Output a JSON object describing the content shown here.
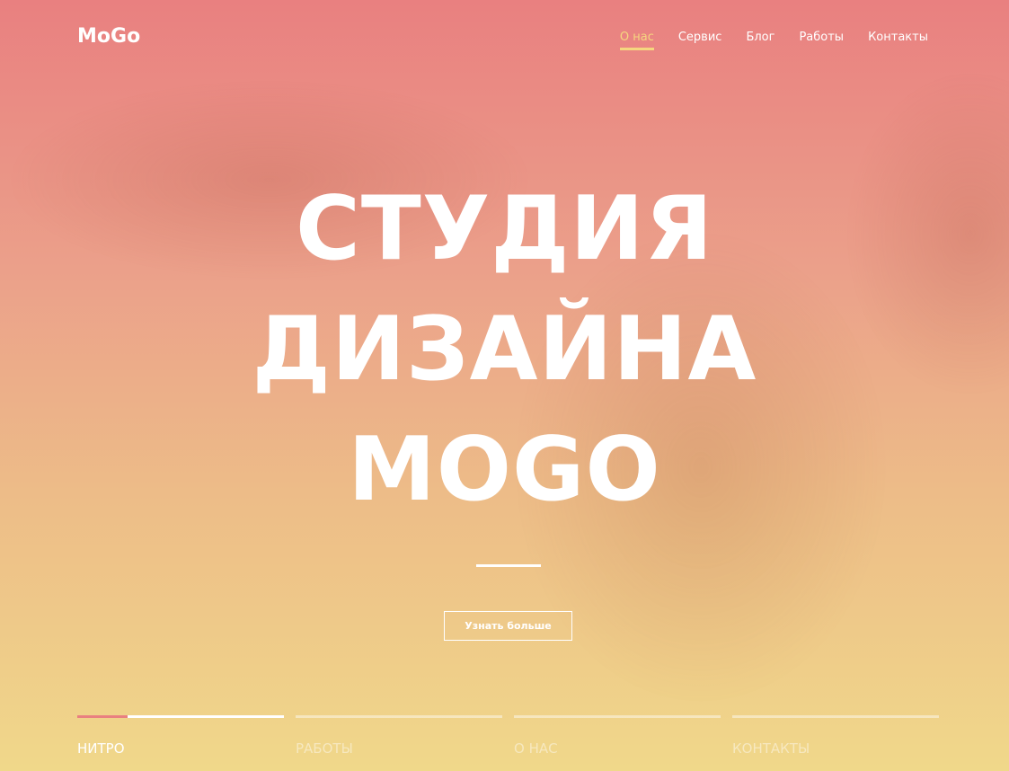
{
  "header": {
    "logo": "MoGo",
    "nav": [
      "О нас",
      "Сервис",
      "Блог",
      "Работы",
      "Контакты"
    ],
    "active_nav": "О нас"
  },
  "hero": {
    "title_lines": [
      "СТУДИЯ",
      "ДИЗАЙНА",
      "MOGO"
    ],
    "button": "Узнать больше"
  },
  "slider": {
    "items": [
      "НИТРО",
      "РАБОТЫ",
      "О НАС",
      "КОНТАКТЫ"
    ],
    "active": "НИТРО",
    "active_progress": 0.24
  },
  "colors": {
    "accent": "#f5d67f",
    "progress": "#e98080"
  }
}
